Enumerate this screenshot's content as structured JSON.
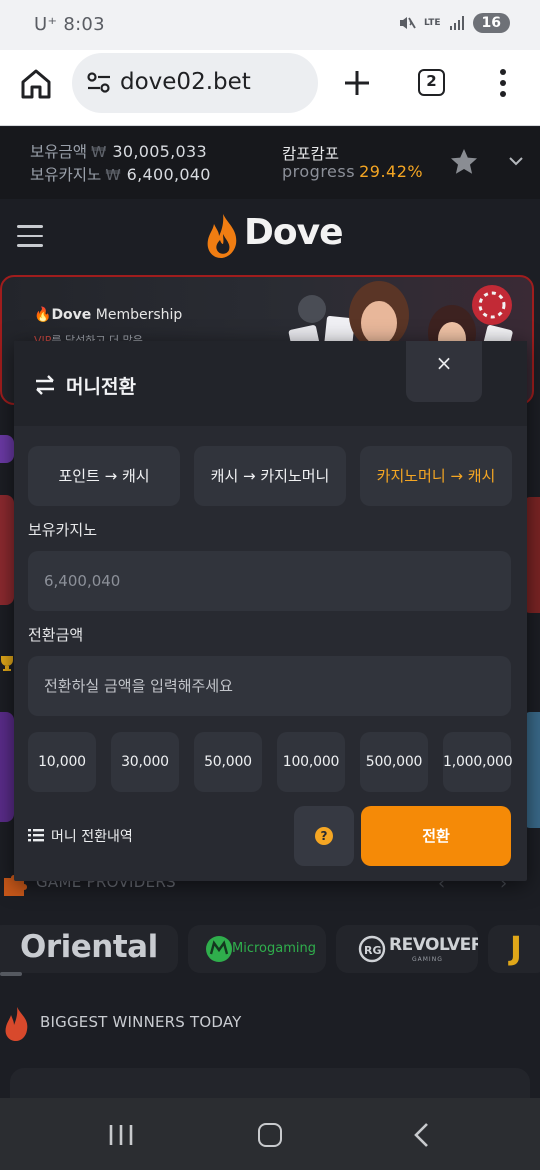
{
  "status_bar": {
    "carrier": "U⁺",
    "time": "8:03",
    "network": "LTE",
    "battery": "16"
  },
  "browser": {
    "url": "dove02.bet",
    "tab_count": "2"
  },
  "account": {
    "balance_label": "보유금액",
    "balance_amount": "30,005,033",
    "casino_label": "보유카지노",
    "casino_amount": "6,400,040",
    "currency_symbol": "₩",
    "level_name": "캄포캄포",
    "progress_label": "progress",
    "progress_value": "29.42%"
  },
  "site": {
    "logo_text": "Dove",
    "banner_brand": "Dove",
    "banner_brand_suffix": "Membership",
    "banner_sub_vip": "VIP",
    "banner_sub_rest": "를 달성하고 더 많은",
    "providers_title": "GAME PROVIDERS",
    "providers": [
      {
        "name": "Oriental"
      },
      {
        "name": "Microgaming"
      },
      {
        "name": "REVOLVER",
        "sub": "GAMING"
      },
      {
        "name": "J"
      }
    ],
    "winners_title": "BIGGEST WINNERS TODAY"
  },
  "modal": {
    "title": "머니전환",
    "close_symbol": "×",
    "tabs": [
      {
        "label": "포인트 → 캐시",
        "active": false
      },
      {
        "label": "캐시 → 카지노머니",
        "active": false
      },
      {
        "label": "카지노머니 → 캐시",
        "active": true
      }
    ],
    "casino_field_label": "보유카지노",
    "casino_field_value": "6,400,040",
    "amount_field_label": "전환금액",
    "amount_field_placeholder": "전환하실 금액을 입력해주세요",
    "amount_buttons": [
      "10,000",
      "30,000",
      "50,000",
      "100,000",
      "500,000",
      "1,000,000"
    ],
    "history_label": "머니 전환내역",
    "help_symbol": "?",
    "submit_label": "전환"
  },
  "colors": {
    "accent": "#f5a623",
    "submit": "#f58a07",
    "modal_bg": "#282a31",
    "field_bg": "#31343c"
  }
}
